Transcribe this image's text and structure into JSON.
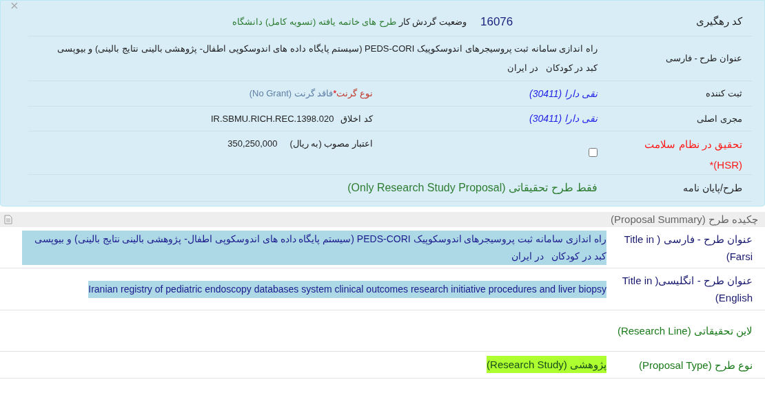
{
  "close": "×",
  "tracking": {
    "label": "کد رهگیری",
    "value": "16076"
  },
  "workflow": {
    "label": "وضعیت گردش کار",
    "value": "طرح های خاتمه یافته (تسویه کامل) دانشگاه"
  },
  "title_fa": {
    "label": "عنوان طرح - فارسی",
    "value": "راه اندازی سامانه ثبت پروسیجرهای اندوسکوپیک PEDS-CORI (سیستم پایگاه داده های اندوسکوپی اطفال- پژوهشی بالینی نتایج بالینی) و بیوپسی کبد در کودکان   در ایران"
  },
  "registrar": {
    "label": "ثبت کننده",
    "value": "نقی دارا (30411)"
  },
  "grant_type": {
    "label": "نوع گرنت",
    "required_mark": "*",
    "value": "فاقد گرنت (No Grant)"
  },
  "executor": {
    "label": "مجری اصلی",
    "value": "نقی دارا (30411)"
  },
  "ethics_code": {
    "label": "کد اخلاق",
    "value": "IR.SBMU.RICH.REC.1398.020"
  },
  "hsr": {
    "label": "تحقیق در نظام سلامت (HSR)",
    "required_mark": "*",
    "checked": false
  },
  "budget": {
    "label": "اعتبار مصوب (به ریال)",
    "value": "350,250,000"
  },
  "proposal_kind": {
    "label": "طرح/پایان نامه",
    "value": "فقط طرح تحقیقاتی (Only Research Study Proposal)"
  },
  "summary": {
    "title": "چکیده طرح (Proposal Summary)",
    "rows": [
      {
        "kind": "title",
        "label": "عنوان طرح - فارسی ( Title in Farsi)",
        "value": "راه اندازی سامانه ثبت پروسیجرهای اندوسکوپیک PEDS-CORI (سیستم پایگاه داده های اندوسکوپی اطفال- پژوهشی بالینی نتایج بالینی) و بیوپسی کبد در کودکان   در ایران",
        "color": "#add8e6"
      },
      {
        "kind": "title",
        "label": "عنوان طرح - انگلیسی( Title in English)",
        "value": "Iranian registry of pediatric endoscopy databases system clinical outcomes research initiative procedures and liver biopsy",
        "color": "#add8e6"
      },
      {
        "kind": "classification",
        "label": "لاین تحقیقاتی (Research Line)"
      },
      {
        "kind": "classification",
        "label": "نوع طرح (Proposal Type)",
        "value": "پژوهشی (Research Study)",
        "color": "#adff2f"
      }
    ]
  }
}
